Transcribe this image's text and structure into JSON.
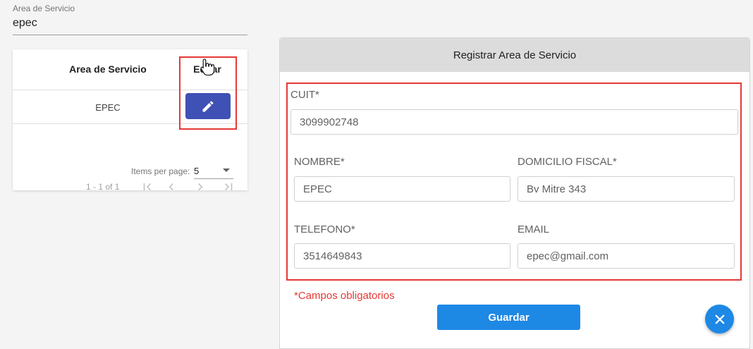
{
  "search": {
    "label": "Area de Servicio",
    "value": "epec"
  },
  "table": {
    "headers": {
      "area": "Area de Servicio",
      "edit": "Editar"
    },
    "rows": [
      {
        "area": "EPEC"
      }
    ],
    "paginator": {
      "range_label": "1 - 1 of 1",
      "items_per_page_label": "Items per page:",
      "page_size": "5"
    }
  },
  "form": {
    "title": "Registrar Area de Servicio",
    "cuit": {
      "label": "CUIT*",
      "value": "3099902748"
    },
    "nombre": {
      "label": "NOMBRE*",
      "value": "EPEC"
    },
    "domicilio": {
      "label": "DOMICILIO FISCAL*",
      "value": "Bv Mitre 343"
    },
    "telefono": {
      "label": "TELEFONO*",
      "value": "3514649843"
    },
    "email": {
      "label": "EMAIL",
      "value": "epec@gmail.com"
    },
    "required_note": "*Campos obligatorios",
    "save_label": "Guardar"
  },
  "icons": {
    "edit": "pencil-icon",
    "close": "close-icon",
    "first_page": "first-page-icon",
    "prev_page": "chevron-left-icon",
    "next_page": "chevron-right-icon",
    "last_page": "last-page-icon",
    "dropdown": "caret-down-icon",
    "cursor": "hand-pointer-icon"
  },
  "colors": {
    "primary_button": "#3f51b5",
    "accent": "#1e88e5",
    "highlight": "#e53935",
    "header_bg": "#dcdcdc"
  }
}
